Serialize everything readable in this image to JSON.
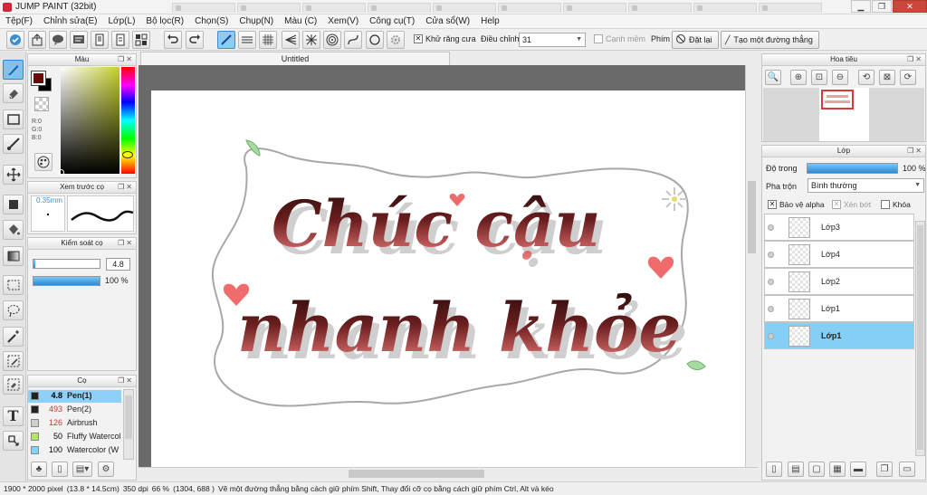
{
  "window": {
    "title": "JUMP PAINT (32bit)",
    "background_tabs": [
      "",
      "",
      "",
      "",
      "",
      "",
      "",
      "",
      "",
      ""
    ],
    "controls": {
      "minimize": "▁",
      "maximize": "❐",
      "close": "✕"
    }
  },
  "menu": {
    "items": [
      "Tệp(F)",
      "Chỉnh sửa(E)",
      "Lớp(L)",
      "Bộ lọc(R)",
      "Chọn(S)",
      "Chụp(N)",
      "Màu (C)",
      "Xem(V)",
      "Công cụ(T)",
      "Cửa sổ(W)",
      "Help"
    ]
  },
  "toolbar": {
    "antialias_label": "Khử răng cưa",
    "antialias_checked": "✕",
    "adjust_label": "Điều chỉnh",
    "adjust_value": "31",
    "edge_label": "Cạnh mềm",
    "key_label": "Phím",
    "reset_label": "Đặt lại",
    "straight_label": "Tạo một đường thẳng"
  },
  "color_panel": {
    "title": "Màu",
    "r_label": "R:0",
    "g_label": "G:0",
    "b_label": "B:0",
    "fg_color": "#6b0808",
    "bg_color": "#000000"
  },
  "brush_preview": {
    "title": "Xem trước cọ",
    "size_label": "0.35mm"
  },
  "brush_control": {
    "title": "Kiểm soát cọ",
    "size_value": "4.8",
    "opacity_value": "100 %",
    "size_level": 0.03,
    "opacity_level": 1.0
  },
  "brushes": {
    "title": "Cọ",
    "items": [
      {
        "size": "4.8",
        "name": "Pen(1)",
        "swatch": "#222222",
        "selected": true,
        "size_color": "#000000"
      },
      {
        "size": "493",
        "name": "Pen(2)",
        "swatch": "#222222",
        "selected": false,
        "size_color": "#c0392b"
      },
      {
        "size": "126",
        "name": "Airbrush",
        "swatch": "#cfcfcf",
        "selected": false,
        "size_color": "#c0392b"
      },
      {
        "size": "50",
        "name": "Fluffy Watercol",
        "swatch": "#b7e36a",
        "selected": false,
        "size_color": "#000000"
      },
      {
        "size": "100",
        "name": "Watercolor (W",
        "swatch": "#7fd6f4",
        "selected": false,
        "size_color": "#000000"
      }
    ]
  },
  "document": {
    "tab_title": "Untitled",
    "line1": "Chúc cậu",
    "line2": "nhanh khỏe"
  },
  "navigator": {
    "title": "Hoa tiêu",
    "zoom_icons": [
      "🔍",
      "⊕",
      "⊡",
      "⊖",
      "⟲",
      "⊠",
      "⟳"
    ]
  },
  "layers": {
    "title": "Lớp",
    "opacity_label": "Độ trong",
    "opacity_value": "100 %",
    "opacity_level": 1.0,
    "blend_label": "Pha trộn",
    "blend_value": "Bình thường",
    "protect_alpha_label": "Bảo vệ alpha",
    "clip_label": "Xén bớt",
    "lock_label": "Khóa",
    "items": [
      {
        "name": "Lớp3",
        "selected": false
      },
      {
        "name": "Lớp4",
        "selected": false
      },
      {
        "name": "Lớp2",
        "selected": false
      },
      {
        "name": "Lớp1",
        "selected": false
      },
      {
        "name": "Lớp1",
        "selected": true
      }
    ]
  },
  "status": {
    "pixels": "1900 * 2000 pixel",
    "physical": "(13.8 * 14.5cm)",
    "dpi": "350 dpi",
    "zoom": "66 %",
    "coords": "(1304, 688 )",
    "hint": "Vẽ một đường thẳng bằng cách giữ phím Shift, Thay đổi cỡ cọ bằng cách giữ phím Ctrl, Alt và kéo"
  },
  "colors": {
    "accent": "#3b8ed0",
    "selection": "#84cff6",
    "lettering_dark": "#3a1010",
    "lettering_pink": "#f07a7a",
    "heart": "#f06c6c",
    "leaf": "#9fd79a"
  }
}
